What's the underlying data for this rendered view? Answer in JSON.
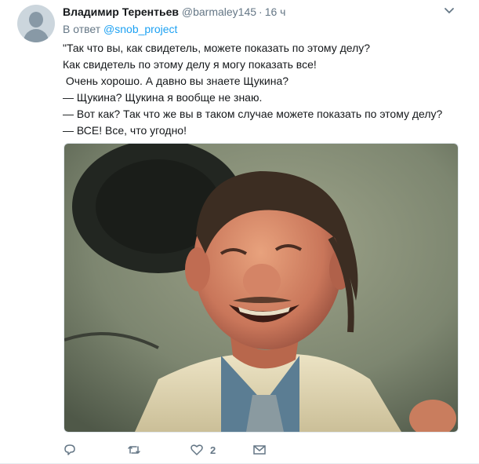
{
  "tweet": {
    "author_name": "Владимир Терентьев",
    "author_handle": "@barmaley145",
    "separator": "·",
    "time": "16 ч",
    "reply_prefix": "В ответ",
    "reply_handle": "@snob_project",
    "lines": [
      "\"Так что вы, как свидетель, можете показать по этому делу?",
      "Как свидетель по этому делу я могу показать все!",
      " Очень хорошо. А давно вы знаете Щукина?",
      "— Щукина? Щукина я вообще не знаю.",
      "— Вот как? Так что же вы в таком случае можете показать по этому делу?",
      "— ВСЕ! Все, что угодно!"
    ],
    "like_count": "2"
  },
  "icons": {
    "avatar": "default-profile-icon",
    "menu": "chevron-down-icon",
    "reply": "reply-icon",
    "retweet": "retweet-icon",
    "like": "heart-icon",
    "dm": "envelope-icon"
  },
  "colors": {
    "link": "#1da1f2",
    "secondary_text": "#657786",
    "primary_text": "#14171a"
  }
}
